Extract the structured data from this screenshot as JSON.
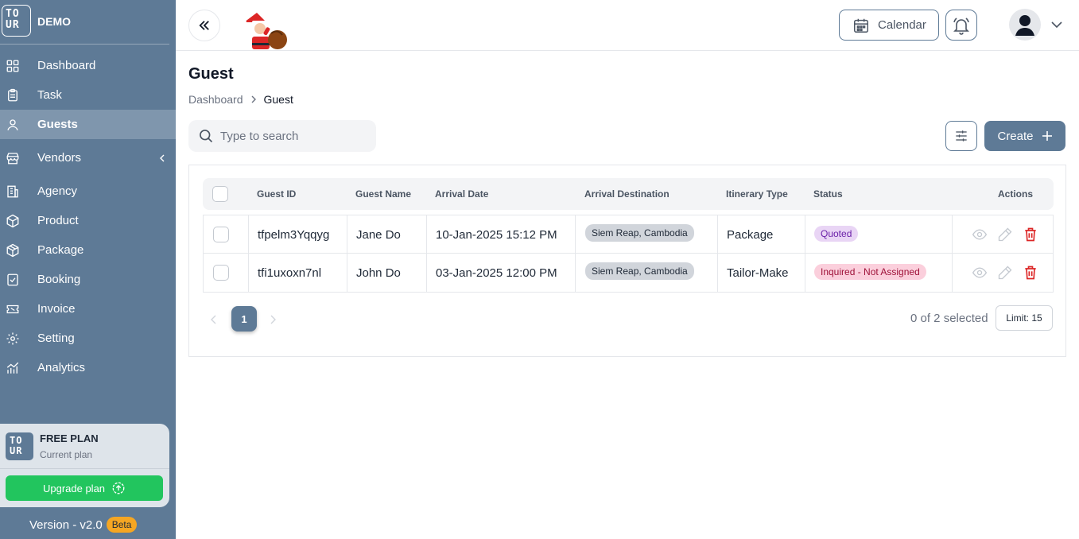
{
  "brand": {
    "name": "DEMO",
    "logo_text_top": "TO",
    "logo_text_bottom": "UR"
  },
  "sidebar": {
    "items": [
      {
        "label": "Dashboard",
        "icon": "dashboard-icon"
      },
      {
        "label": "Task",
        "icon": "clipboard-icon"
      },
      {
        "label": "Guests",
        "icon": "user-icon",
        "active": true
      },
      {
        "label": "Vendors",
        "icon": "store-icon"
      },
      {
        "label": "Agency",
        "icon": "building-icon"
      },
      {
        "label": "Product",
        "icon": "box-icon"
      },
      {
        "label": "Package",
        "icon": "package-icon"
      },
      {
        "label": "Booking",
        "icon": "booking-icon"
      },
      {
        "label": "Invoice",
        "icon": "ticket-icon"
      },
      {
        "label": "Setting",
        "icon": "gear-icon"
      },
      {
        "label": "Analytics",
        "icon": "chart-icon"
      }
    ]
  },
  "plan": {
    "title": "FREE PLAN",
    "subtitle": "Current plan",
    "upgrade_label": "Upgrade plan"
  },
  "version": {
    "label": "Version - v2.0",
    "badge": "Beta"
  },
  "topbar": {
    "calendar_label": "Calendar"
  },
  "page": {
    "title": "Guest",
    "breadcrumb": [
      "Dashboard",
      "Guest"
    ]
  },
  "search": {
    "placeholder": "Type to search"
  },
  "toolbar": {
    "create_label": "Create"
  },
  "table": {
    "headers": [
      "Guest ID",
      "Guest Name",
      "Arrival Date",
      "Arrival Destination",
      "Itinerary Type",
      "Status",
      "Actions"
    ],
    "rows": [
      {
        "id": "tfpelm3Yqqyg",
        "name": "Jane Do",
        "date": "10-Jan-2025 15:12 PM",
        "destination": "Siem Reap, Cambodia",
        "type": "Package",
        "status": "Quoted"
      },
      {
        "id": "tfi1uxoxn7nl",
        "name": "John Do",
        "date": "03-Jan-2025 12:00 PM",
        "destination": "Siem Reap, Cambodia",
        "type": "Tailor-Make",
        "status": "Inquired - Not Assigned"
      }
    ]
  },
  "pagination": {
    "current_page": "1",
    "selected_info": "0 of 2 selected",
    "limit_label": "Limit: 15"
  },
  "colors": {
    "sidebar": "#5e7a96",
    "accent": "#5e7a96",
    "upgrade": "#22c55e",
    "delete": "#dc2626"
  }
}
